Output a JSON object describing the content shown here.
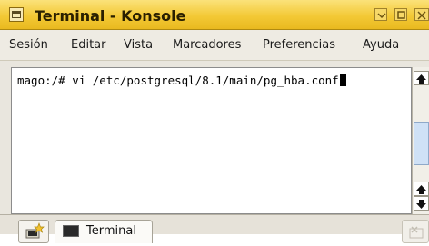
{
  "window": {
    "title": "Terminal - Konsole"
  },
  "menubar": {
    "items": [
      "Sesión",
      "Editar",
      "Vista",
      "Marcadores",
      "Preferencias",
      "Ayuda"
    ]
  },
  "terminal": {
    "command_line": "mago:/# vi /etc/postgresql/8.1/main/pg_hba.conf"
  },
  "tabs": [
    {
      "label": "Terminal",
      "icon": "terminal-icon"
    }
  ],
  "icons": {
    "app": "konsole-app-icon",
    "titlebar": [
      "minimize-icon",
      "maximize-icon",
      "close-icon"
    ],
    "new_tab": "new-session-icon",
    "close_tab": "close-session-icon"
  },
  "colors": {
    "titlebar": "#f3c936",
    "scroll_thumb": "#cfe1f6"
  }
}
